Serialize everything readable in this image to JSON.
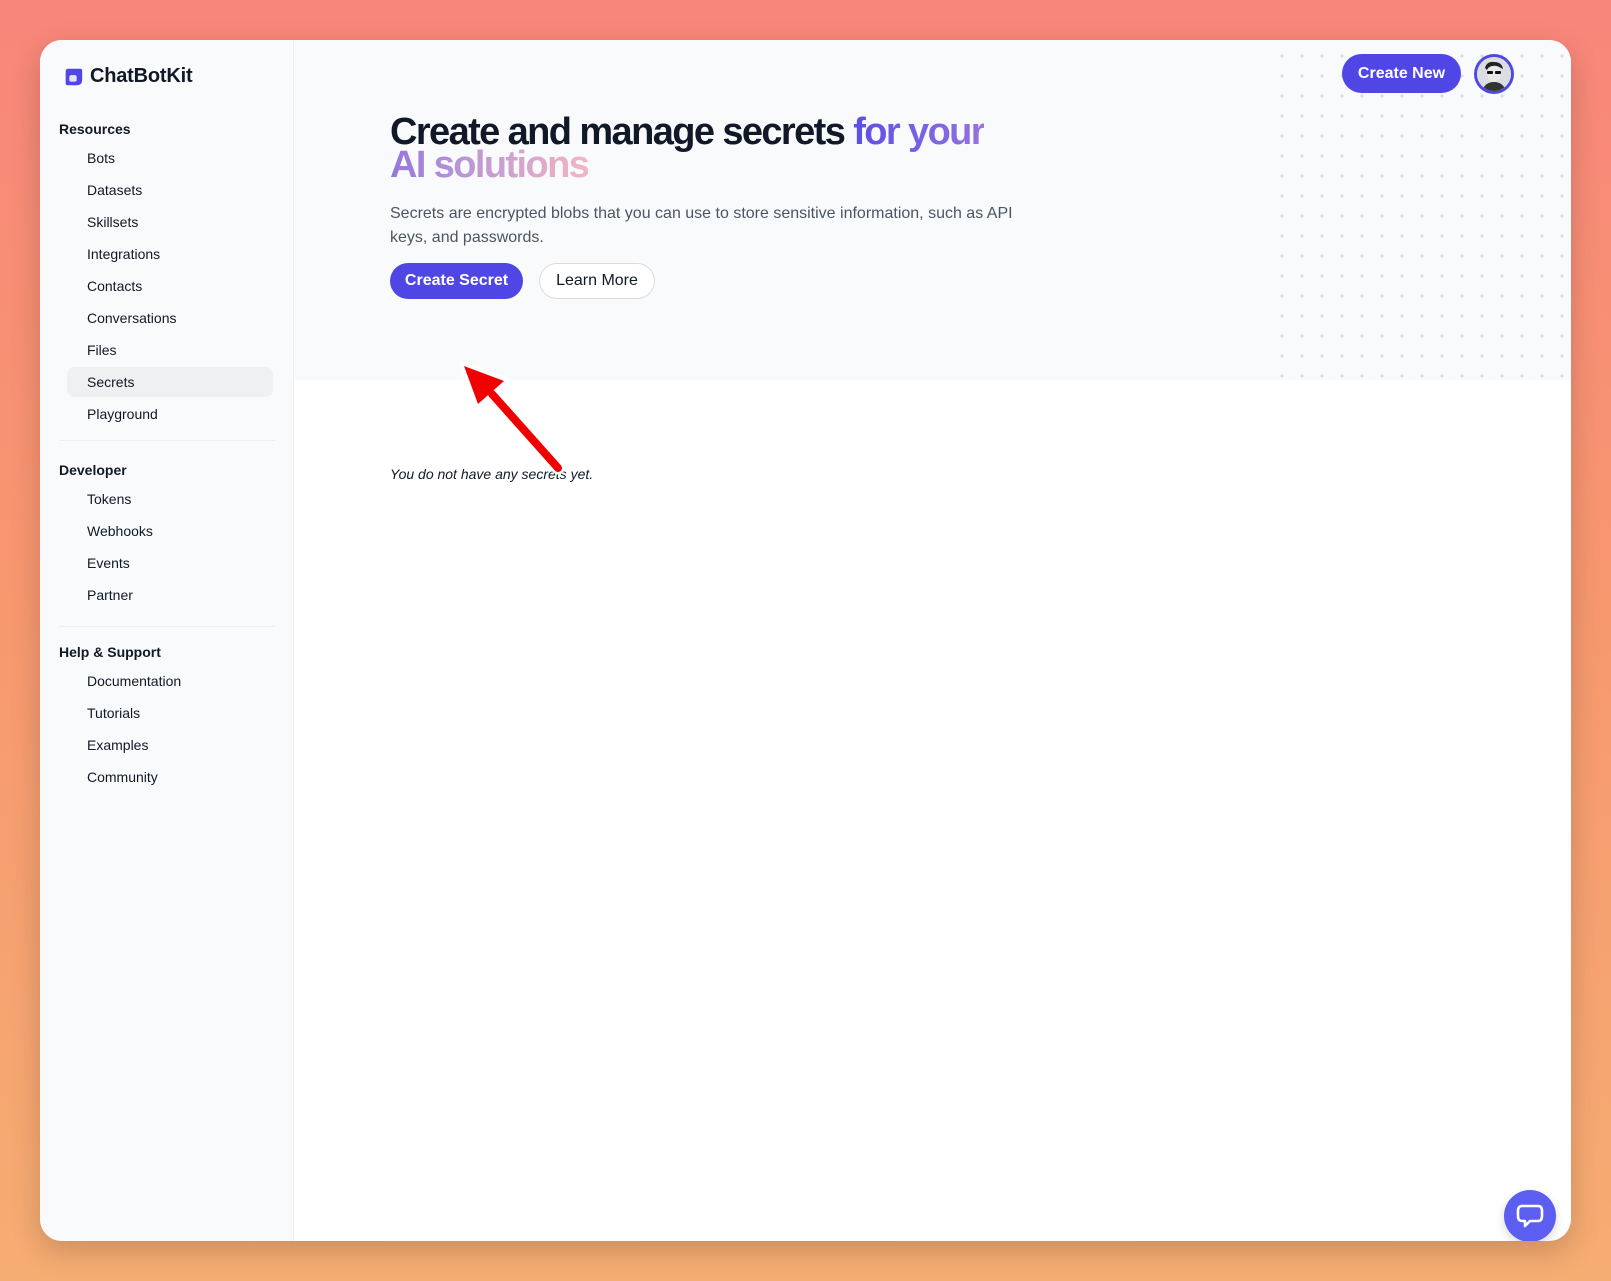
{
  "app": {
    "name": "ChatBotKit"
  },
  "sidebar": {
    "sections": [
      {
        "heading": "Resources",
        "items": [
          "Bots",
          "Datasets",
          "Skillsets",
          "Integrations",
          "Contacts",
          "Conversations",
          "Files",
          "Secrets",
          "Playground"
        ]
      },
      {
        "heading": "Developer",
        "items": [
          "Tokens",
          "Webhooks",
          "Events",
          "Partner"
        ]
      },
      {
        "heading": "Help & Support",
        "items": [
          "Documentation",
          "Tutorials",
          "Examples",
          "Community"
        ]
      }
    ],
    "active_item": "Secrets"
  },
  "header": {
    "create_new_label": "Create New"
  },
  "hero": {
    "title_main": "Create and manage secrets",
    "title_accent": "for your AI solutions",
    "description": "Secrets are encrypted blobs that you can use to store sensitive information, such as API keys, and passwords.",
    "create_secret_label": "Create Secret",
    "learn_more_label": "Learn More"
  },
  "content": {
    "empty_message": "You do not have any secrets yet."
  },
  "colors": {
    "primary": "#4f46e5",
    "annotation_arrow": "#f00000"
  },
  "icons": {
    "logo": "chatbotkit-logo-icon",
    "avatar": "user-avatar",
    "chat": "chat-bubble-icon",
    "annotation": "red-arrow-annotation"
  }
}
